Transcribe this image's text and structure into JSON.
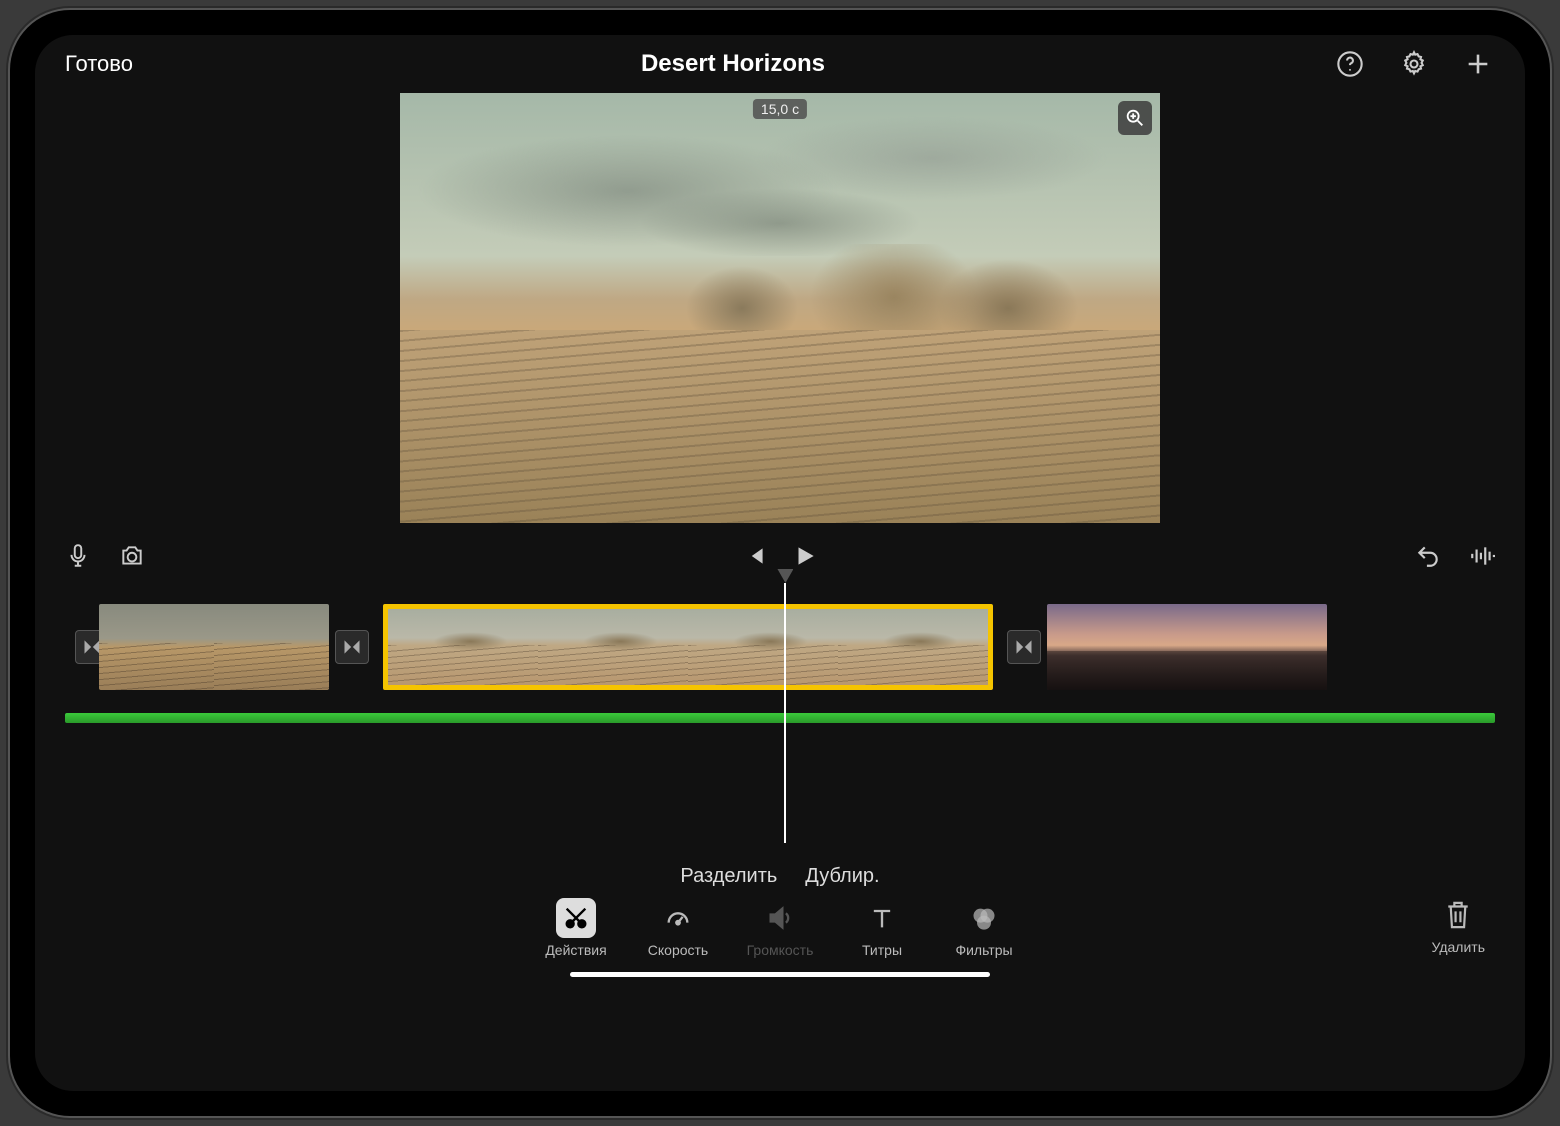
{
  "header": {
    "done_label": "Готово",
    "title": "Desert Horizons",
    "help_icon": "help-icon",
    "settings_icon": "gear-icon",
    "add_icon": "plus-icon"
  },
  "preview": {
    "duration_badge": "15,0 с",
    "zoom_icon": "zoom-in-icon"
  },
  "transport": {
    "mic_icon": "microphone-icon",
    "camera_icon": "camera-icon",
    "prev_icon": "skip-start-icon",
    "play_icon": "play-icon",
    "undo_icon": "undo-icon",
    "waveform_icon": "waveform-icon"
  },
  "timeline": {
    "clips": [
      "clip-1",
      "clip-2-selected",
      "clip-3"
    ],
    "audio_track": "audio-track",
    "transition_icon": "transition-icon",
    "ken_burns_icon": "ken-burns-chip-icon"
  },
  "actions": {
    "split": "Разделить",
    "duplicate": "Дублир."
  },
  "toolbar": {
    "items": [
      {
        "label": "Действия",
        "icon": "scissors-icon",
        "active": true,
        "enabled": true
      },
      {
        "label": "Скорость",
        "icon": "gauge-icon",
        "active": false,
        "enabled": true
      },
      {
        "label": "Громкость",
        "icon": "speaker-icon",
        "active": false,
        "enabled": false
      },
      {
        "label": "Титры",
        "icon": "text-icon",
        "active": false,
        "enabled": true
      },
      {
        "label": "Фильтры",
        "icon": "filters-icon",
        "active": false,
        "enabled": true
      }
    ],
    "delete_label": "Удалить",
    "delete_icon": "trash-icon"
  }
}
